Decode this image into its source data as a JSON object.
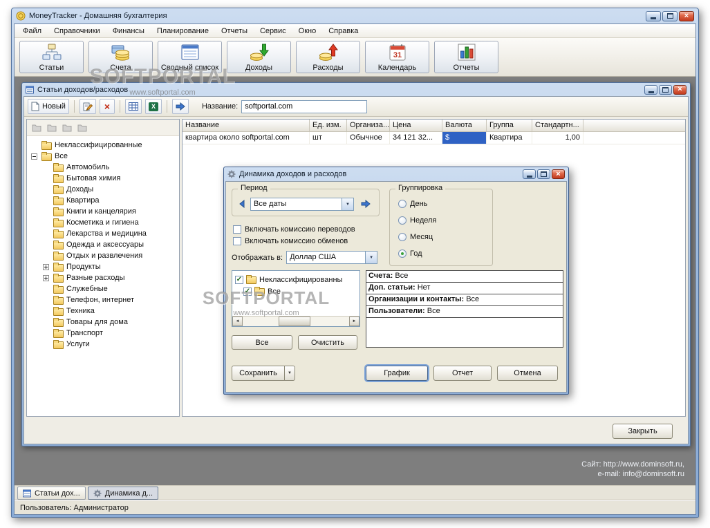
{
  "window": {
    "title": "MoneyTracker - Домашняя бухгалтерия",
    "status": "Пользователь: Администратор"
  },
  "menu": {
    "items": [
      {
        "label": "Файл",
        "name": "menu-file"
      },
      {
        "label": "Справочники",
        "name": "menu-directories"
      },
      {
        "label": "Финансы",
        "name": "menu-finances"
      },
      {
        "label": "Планирование",
        "name": "menu-planning"
      },
      {
        "label": "Отчеты",
        "name": "menu-reports"
      },
      {
        "label": "Сервис",
        "name": "menu-service"
      },
      {
        "label": "Окно",
        "name": "menu-window"
      },
      {
        "label": "Справка",
        "name": "menu-help"
      }
    ]
  },
  "toolbar": {
    "items": [
      {
        "label": "Статьи",
        "name": "articles-button",
        "icon": "articles-icon"
      },
      {
        "label": "Счета",
        "name": "accounts-button",
        "icon": "accounts-icon"
      },
      {
        "label": "Сводный список",
        "name": "summary-list-button",
        "icon": "summary-list-icon"
      },
      {
        "label": "Доходы",
        "name": "income-button",
        "icon": "income-icon"
      },
      {
        "label": "Расходы",
        "name": "expenses-button",
        "icon": "expenses-icon"
      },
      {
        "label": "Календарь",
        "name": "calendar-button",
        "icon": "calendar-icon",
        "day": "31"
      },
      {
        "label": "Отчеты",
        "name": "reports-button",
        "icon": "reports-icon"
      }
    ]
  },
  "child_window": {
    "title": "Статьи доходов/расходов",
    "toolbar": {
      "new_button": "Новый",
      "name_label": "Название:",
      "name_value": "softportal.com"
    },
    "close_button": "Закрыть",
    "tree": [
      {
        "label": "Неклассифицированные",
        "level": 0,
        "expander": null
      },
      {
        "label": "Все",
        "level": 0,
        "expander": "minus"
      },
      {
        "label": "Автомобиль",
        "level": 1,
        "expander": null
      },
      {
        "label": "Бытовая химия",
        "level": 1,
        "expander": null
      },
      {
        "label": "Доходы",
        "level": 1,
        "expander": null
      },
      {
        "label": "Квартира",
        "level": 1,
        "expander": null
      },
      {
        "label": "Книги и канцелярия",
        "level": 1,
        "expander": null
      },
      {
        "label": "Косметика и гигиена",
        "level": 1,
        "expander": null
      },
      {
        "label": "Лекарства и медицина",
        "level": 1,
        "expander": null
      },
      {
        "label": "Одежда и аксессуары",
        "level": 1,
        "expander": null
      },
      {
        "label": "Отдых и развлечения",
        "level": 1,
        "expander": null
      },
      {
        "label": "Продукты",
        "level": 1,
        "expander": "plus"
      },
      {
        "label": "Разные расходы",
        "level": 1,
        "expander": "plus"
      },
      {
        "label": "Служебные",
        "level": 1,
        "expander": null
      },
      {
        "label": "Телефон, интернет",
        "level": 1,
        "expander": null
      },
      {
        "label": "Техника",
        "level": 1,
        "expander": null
      },
      {
        "label": "Товары для дома",
        "level": 1,
        "expander": null
      },
      {
        "label": "Транспорт",
        "level": 1,
        "expander": null
      },
      {
        "label": "Услуги",
        "level": 1,
        "expander": null
      }
    ],
    "table": {
      "columns": [
        "Название",
        "Ед. изм.",
        "Организа...",
        "Цена",
        "Валюта",
        "Группа",
        "Стандартн..."
      ],
      "rows": [
        {
          "cells": [
            "квартира около softportal.com",
            "шт",
            "Обычное",
            "34 121 32...",
            "$",
            "Квартира",
            "1,00"
          ],
          "selected_cell": 4
        }
      ]
    }
  },
  "dialog": {
    "title": "Динамика доходов и расходов",
    "period_group": {
      "label": "Период",
      "value": "Все даты"
    },
    "grouping_group": {
      "label": "Группировка",
      "options": [
        {
          "label": "День",
          "selected": false
        },
        {
          "label": "Неделя",
          "selected": false
        },
        {
          "label": "Месяц",
          "selected": false
        },
        {
          "label": "Год",
          "selected": true
        }
      ]
    },
    "checkboxes": [
      {
        "label": "Включать комиссию переводов",
        "checked": false
      },
      {
        "label": "Включать комиссию обменов",
        "checked": false
      }
    ],
    "display_in": {
      "label": "Отображать в:",
      "value": "Доллар США"
    },
    "categories": [
      {
        "label": "Неклассифицированны",
        "checked": true
      },
      {
        "label": "Все",
        "checked": true
      }
    ],
    "summary": [
      {
        "label": "Счета:",
        "value": "Все"
      },
      {
        "label": "Доп. статьи:",
        "value": "Нет"
      },
      {
        "label": "Организации и контакты:",
        "value": "Все"
      },
      {
        "label": "Пользователи:",
        "value": "Все"
      }
    ],
    "buttons": {
      "select_all": "Все",
      "clear": "Очистить",
      "save": "Сохранить",
      "chart": "График",
      "report": "Отчет",
      "cancel": "Отмена"
    }
  },
  "footer": {
    "site_line1": "Сайт: http://www.dominsoft.ru,",
    "site_line2": "e-mail: info@dominsoft.ru",
    "tabs": [
      {
        "label": "Статьи дох...",
        "icon": "list-icon",
        "active": false,
        "name": "task-tab-articles"
      },
      {
        "label": "Динамика д...",
        "icon": "gear-icon",
        "active": true,
        "name": "task-tab-dynamics"
      }
    ]
  },
  "watermark": {
    "brand": "SOFTPORTAL",
    "url": "www.softportal.com"
  }
}
